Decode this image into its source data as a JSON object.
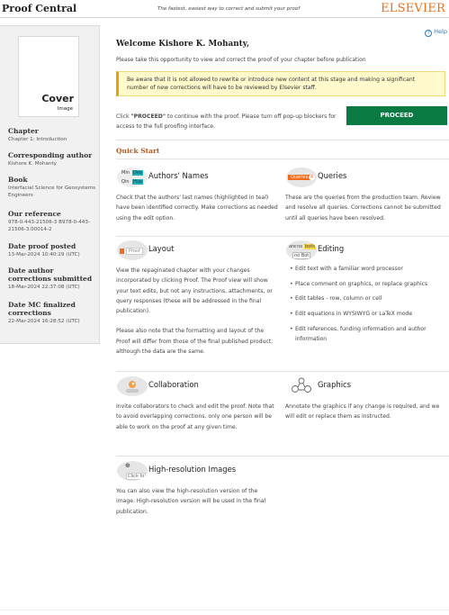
{
  "header": {
    "brand": "Proof Central",
    "tagline": "The fastest, easiest way to correct and submit your proof",
    "publisher": "ELSEVIER"
  },
  "sidebar": {
    "cover_title": "Cover",
    "cover_subtitle": "Image",
    "sections": [
      {
        "label": "Chapter",
        "value": "Chapter 1: Introduction"
      },
      {
        "label": "Corresponding author",
        "value": "Kishore K. Mohanty"
      },
      {
        "label": "Book",
        "value": "Interfacial Science for Geosystems Engineers"
      },
      {
        "label": "Our reference",
        "value": "978-0-443-21506-3 B978-0-443-21506-3.00014-2"
      },
      {
        "label": "Date proof posted",
        "value": "13-Mar-2024 10:40:29 (UTC)"
      },
      {
        "label": "Date author corrections submitted",
        "value": "18-Mar-2024 22:37:08 (UTC)"
      },
      {
        "label": "Date MC finalized corrections",
        "value": "22-Mar-2024 16:28:52 (UTC)"
      }
    ]
  },
  "help": {
    "label": "Help",
    "icon": "?"
  },
  "main": {
    "welcome": "Welcome Kishore K. Mohanty,",
    "intro": "Please take this opportunity to view and correct the proof of your chapter before publication",
    "warning": "Be aware that it is not allowed to rewrite or introduce new content at this stage and making a significant number of new corrections will have to be reviewed by Elsevier staff.",
    "proceed_note_prefix": "Click ",
    "proceed_note_strong": "\"PROCEED\"",
    "proceed_note_suffix": " to continue with the proof. Please turn off pop-up blockers for access to the full proofing interface.",
    "proceed_button": "PROCEED",
    "quick_start": "Quick Start"
  },
  "cards": {
    "authors": {
      "title": "Authors' Names",
      "icon_text": [
        "Min",
        "Dea",
        "Qin",
        "Hua"
      ],
      "body": "Check that the authors' last names (highlighted in teal) have been identified correctly. Make corrections as needed using the edit option."
    },
    "queries": {
      "title": "Queries",
      "icon_text": "Queries",
      "icon_badge": "4",
      "body": "These are the queries from the production team. Review and resolve all queries. Corrections cannot be submitted until all queries have been resolved."
    },
    "layout": {
      "title": "Layout",
      "icon_text": "Proof",
      "body1": "View the repaginated chapter with your changes incorporated by clicking Proof. The Proof view will show your text edits, but not any instructions, attachments, or query responses (these will be addressed in the final publication).",
      "body2": "Please also note that the formatting and layout of the Proof will differ from those of the final published product, although the data are the same."
    },
    "editing": {
      "title": "Editing",
      "icon_text": [
        "are",
        "no",
        "both",
        "no Bot"
      ],
      "items": [
        "Edit text with a familiar word processor",
        "Place comment on graphics, or replace graphics",
        "Edit tables - row, column or cell",
        "Edit equations in WYSIWYG or LaTeX mode",
        "Edit references, funding information and author information"
      ]
    },
    "collaboration": {
      "title": "Collaboration",
      "body": "Invite collaborators to check and edit the proof. Note that to avoid overlapping corrections, only one person will be able to work on the proof at any given time."
    },
    "graphics": {
      "title": "Graphics",
      "body": "Annotate the graphics if any change is required, and we will edit or replace them as instructed."
    },
    "hires": {
      "title": "High-resolution Images",
      "icon_text": "Click fo",
      "body": "You can also view the high-resolution version of the image. High-resolution version will be used in the final publication."
    }
  },
  "colors": {
    "proceed": "#087a42",
    "accent_orange": "#e9711c",
    "quick_start": "#b35a1f",
    "teal_highlight": "#20b0b4",
    "warning_bg": "#fff9cc",
    "help_link": "#2f78b7"
  }
}
